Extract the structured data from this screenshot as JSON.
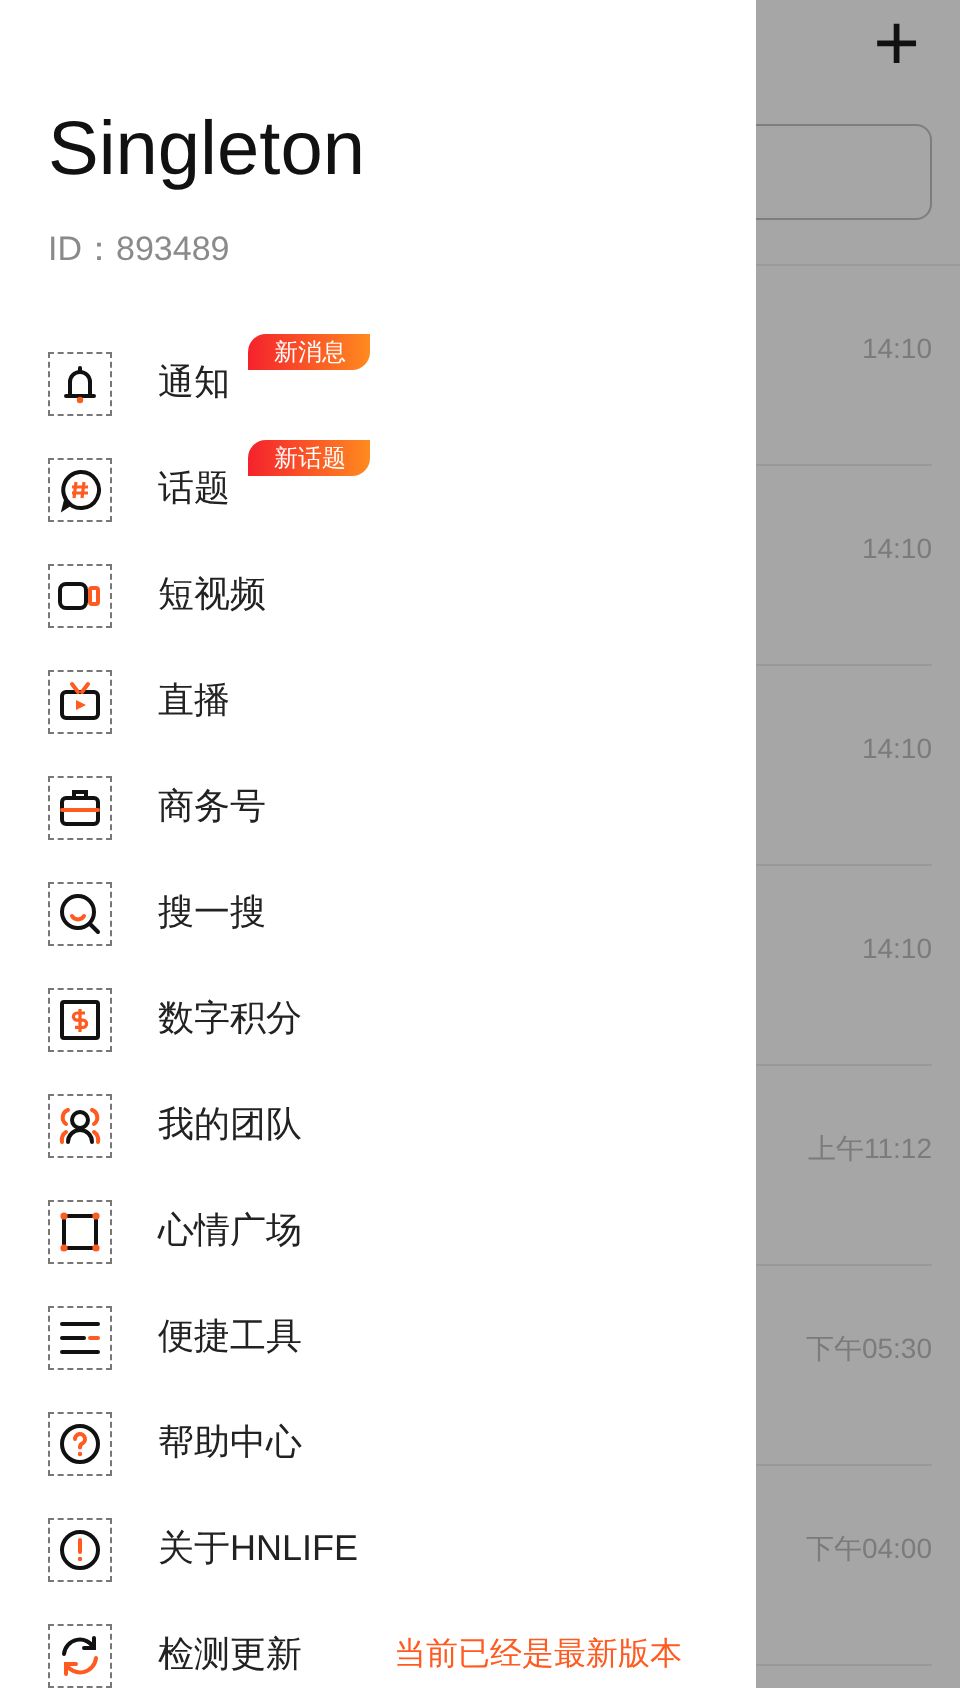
{
  "drawer": {
    "title": "Singleton",
    "user_id": "ID：893489",
    "items": [
      {
        "label": "通知",
        "badge": "新消息"
      },
      {
        "label": "话题",
        "badge": "新话题"
      },
      {
        "label": "短视频"
      },
      {
        "label": "直播"
      },
      {
        "label": "商务号"
      },
      {
        "label": "搜一搜"
      },
      {
        "label": "数字积分"
      },
      {
        "label": "我的团队"
      },
      {
        "label": "心情广场"
      },
      {
        "label": "便捷工具"
      },
      {
        "label": "帮助中心"
      },
      {
        "label": "关于HNLIFE"
      },
      {
        "label": "检测更新",
        "note": "当前已经是最新版本"
      }
    ]
  },
  "background": {
    "add_button": "+",
    "chats": [
      {
        "time": "14:10"
      },
      {
        "time": "14:10"
      },
      {
        "time": "14:10"
      },
      {
        "time": "14:10"
      },
      {
        "time": "上午11:12"
      },
      {
        "time": "下午05:30"
      },
      {
        "time": "下午04:00"
      }
    ]
  }
}
